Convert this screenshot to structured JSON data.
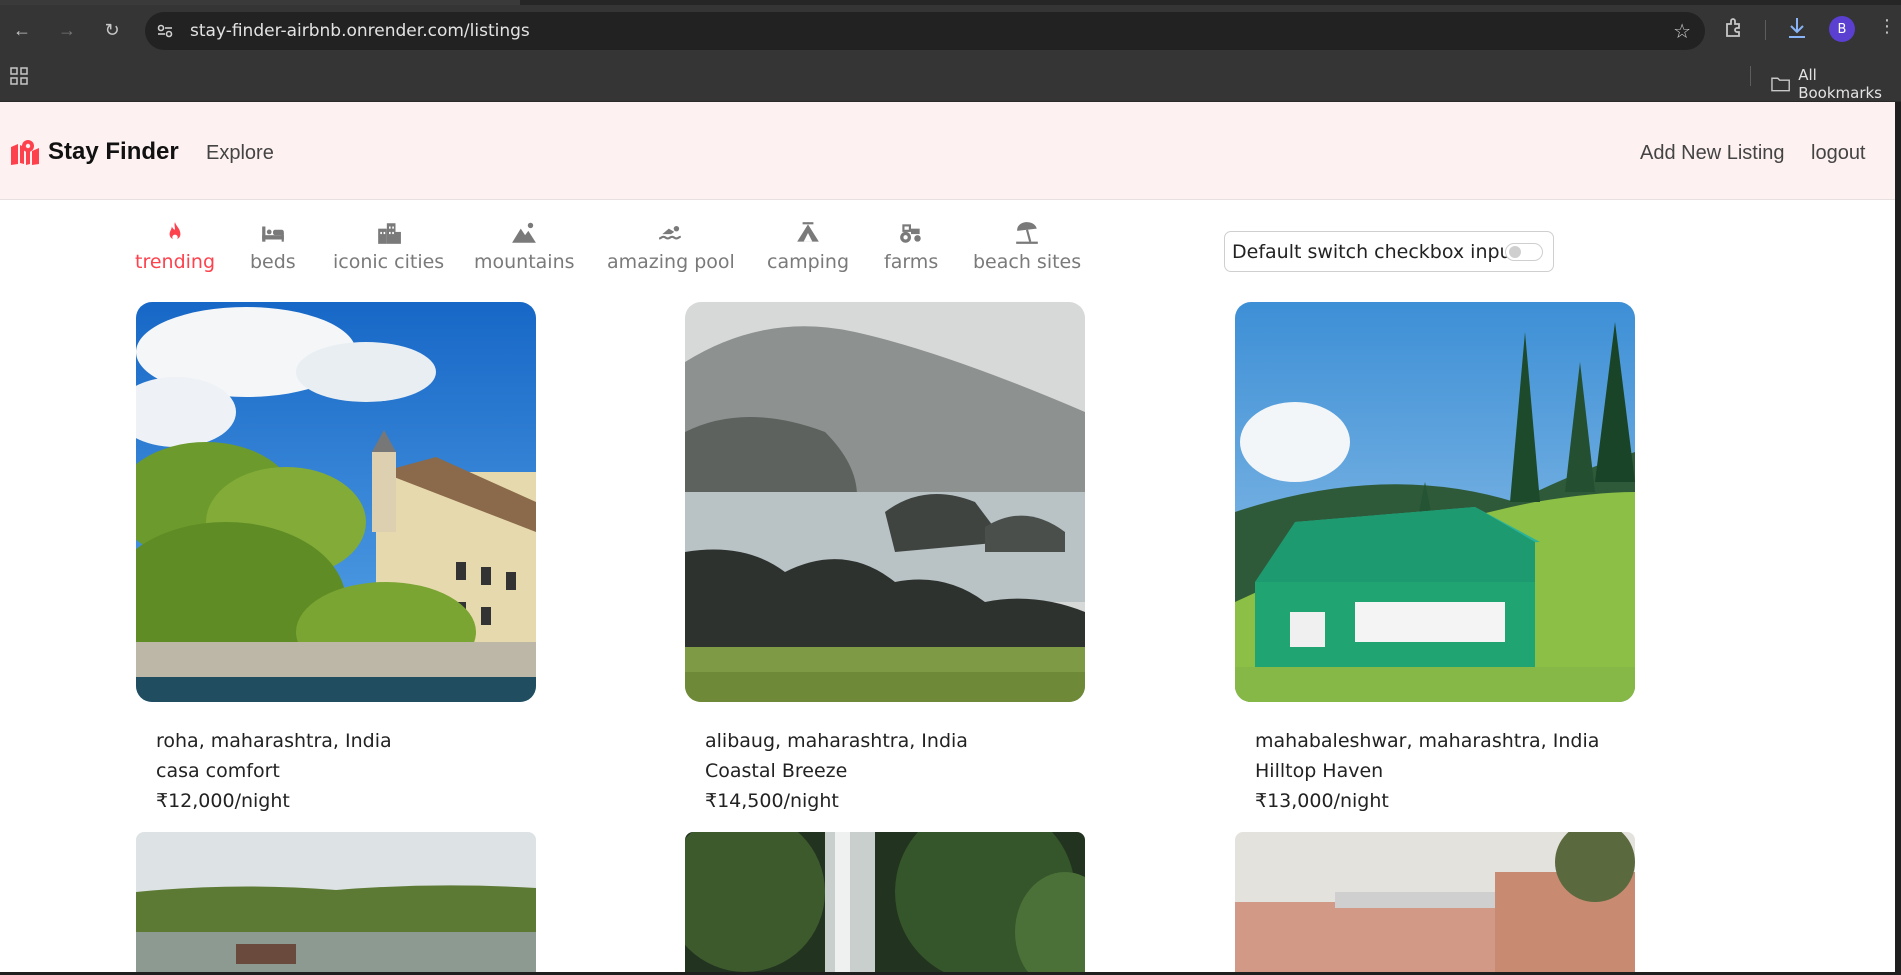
{
  "browser": {
    "url": "stay-finder-airbnb.onrender.com/listings",
    "profile_initial": "B",
    "all_bookmarks_label": "All Bookmarks"
  },
  "navbar": {
    "brand": "Stay Finder",
    "explore": "Explore",
    "add_listing": "Add New Listing",
    "logout": "logout",
    "brand_color": "#fe424d"
  },
  "filters": [
    {
      "label": "trending",
      "icon": "fire-icon",
      "active": true
    },
    {
      "label": "beds",
      "icon": "bed-icon"
    },
    {
      "label": "iconic cities",
      "icon": "city-icon"
    },
    {
      "label": "mountains",
      "icon": "mountain-icon"
    },
    {
      "label": "amazing pool",
      "icon": "swimmer-icon"
    },
    {
      "label": "camping",
      "icon": "campground-icon"
    },
    {
      "label": "farms",
      "icon": "tractor-icon"
    },
    {
      "label": "beach sites",
      "icon": "umbrella-beach-icon"
    }
  ],
  "tax_toggle": {
    "label": "Default switch checkbox input",
    "checked": false
  },
  "listings": [
    {
      "location": "roha, maharashtra, India",
      "title": "casa comfort",
      "price": "₹12,000/night",
      "image": "villa on lake with garden"
    },
    {
      "location": "alibaug, maharashtra, India",
      "title": "Coastal Breeze",
      "price": "₹14,500/night",
      "image": "misty coastal cliffs"
    },
    {
      "location": "mahabaleshwar, maharashtra, India",
      "title": "Hilltop Haven",
      "price": "₹13,000/night",
      "image": "green cottage on hillside"
    },
    {
      "image": "lake with trees"
    },
    {
      "image": "waterfall in forest"
    },
    {
      "image": "pink building with balconies"
    }
  ]
}
